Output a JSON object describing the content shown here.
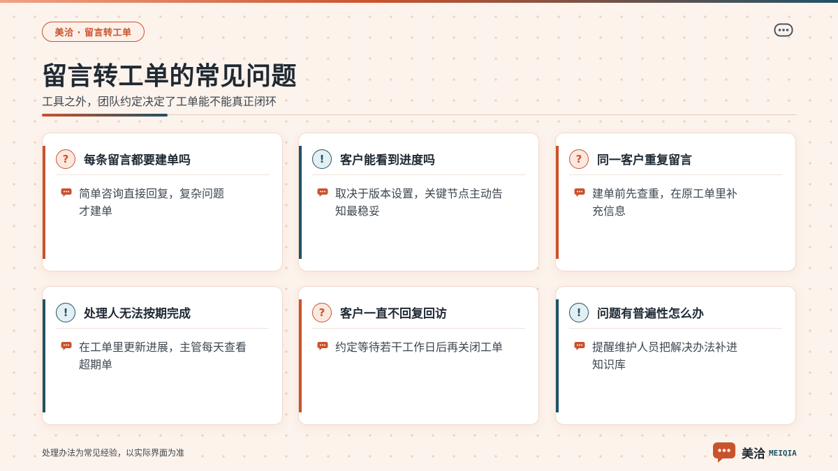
{
  "brand": {
    "pill": "美洽 · 留言转工单",
    "logo_name": "美洽",
    "logo_en": "MEIQIA"
  },
  "header": {
    "title": "留言转工单的常见问题",
    "subtitle": "工具之外，团队约定决定了工单能不能真正闭环"
  },
  "cards": [
    {
      "badge": "?",
      "title": "每条留言都要建单吗",
      "text": "简单咨询直接回复，复杂问题才建单",
      "line1": "简单咨询直接回复，复杂问题",
      "line2": "才建单"
    },
    {
      "badge": "!",
      "title": "客户能看到进度吗",
      "text": "取决于版本设置，关键节点主动告知最稳妥",
      "line1": "取决于版本设置，关键节点主动告",
      "line2": "知最稳妥"
    },
    {
      "badge": "?",
      "title": "同一客户重复留言",
      "text": "建单前先查重，在原工单里补充信息",
      "line1": "建单前先查重，在原工单里补",
      "line2": "充信息"
    },
    {
      "badge": "!",
      "title": "处理人无法按期完成",
      "text": "在工单里更新进展，主管每天查看超期单",
      "line1": "在工单里更新进展，主管每天查看",
      "line2": "超期单"
    },
    {
      "badge": "?",
      "title": "客户一直不回复回访",
      "text": "约定等待若干工作日后再关闭工单",
      "line1": "约定等待若干工作日后再关闭工单",
      "line2": ""
    },
    {
      "badge": "!",
      "title": "问题有普遍性怎么办",
      "text": "提醒维护人员把解决办法补进知识库",
      "line1": "提醒维护人员把解决办法补进",
      "line2": "知识库"
    }
  ],
  "footer": {
    "note": "处理办法为常见经验，以实际界面为准"
  },
  "colors": {
    "accent_orange": "#c9532d",
    "accent_teal": "#1f5266",
    "background": "#fcf3ec"
  },
  "icons": {
    "top_right": "chat-bubble-icon",
    "card_body": "speech-bubble-icon",
    "footer": "meiqia-logo-icon"
  }
}
